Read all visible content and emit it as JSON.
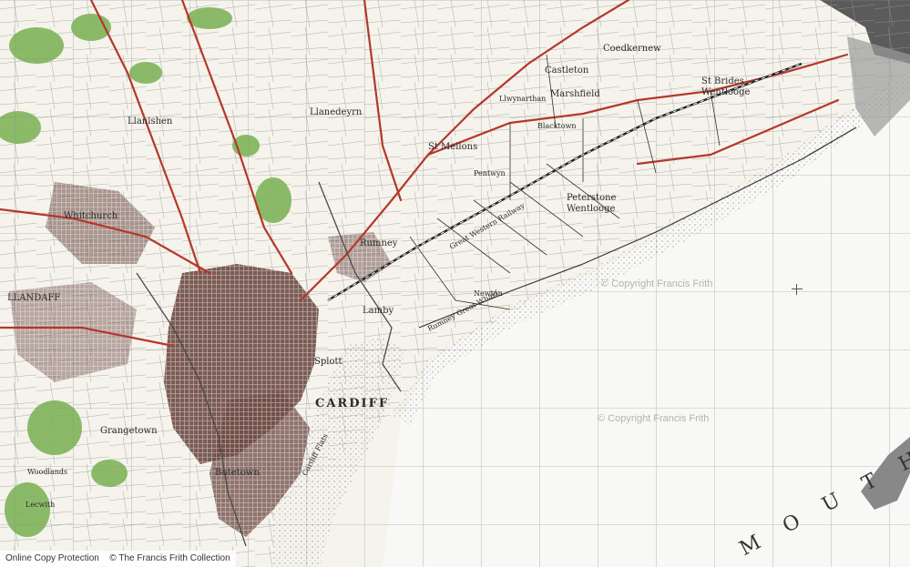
{
  "map": {
    "watermarks": [
      "© Copyright Francis Frith",
      "© Copyright Francis Frith"
    ],
    "places": {
      "cardiff": "CARDIFF",
      "castleton": "Castleton",
      "coedkernew": "Coedkernew",
      "marshfield": "Marshfield",
      "st_brides": "St Brides",
      "wentlooge": "Wentlooge",
      "st_mellons": "St Mellons",
      "peterstone": "Peterstone",
      "peterstone_wentlooge": "Wentlooge",
      "rumney": "Rumney",
      "llanedeyrn": "Llanedeyrn",
      "llanishen": "Llanishen",
      "llandaff": "LLANDAFF",
      "whitchurch": "Whitchurch",
      "splott": "Splott",
      "butetown": "Butetown",
      "grangetown": "Grangetown",
      "llanrumney": "Lamby",
      "newton": "Newton",
      "cardiff_flats": "Cardiff Flats",
      "rumney_great_wharf": "Rumney Great Wharf",
      "great_western_railway": "Great Western Railway",
      "blacktown": "Blacktown",
      "llwynarthan": "Llwynarthan",
      "pontprennau": "Pentwyn",
      "woodlands": "Woodlands",
      "lockwith": "Lecwith"
    },
    "estuary_label": "M O U T H"
  },
  "footer": {
    "left": "Online Copy Protection",
    "right": "© The Francis Frith Collection"
  }
}
